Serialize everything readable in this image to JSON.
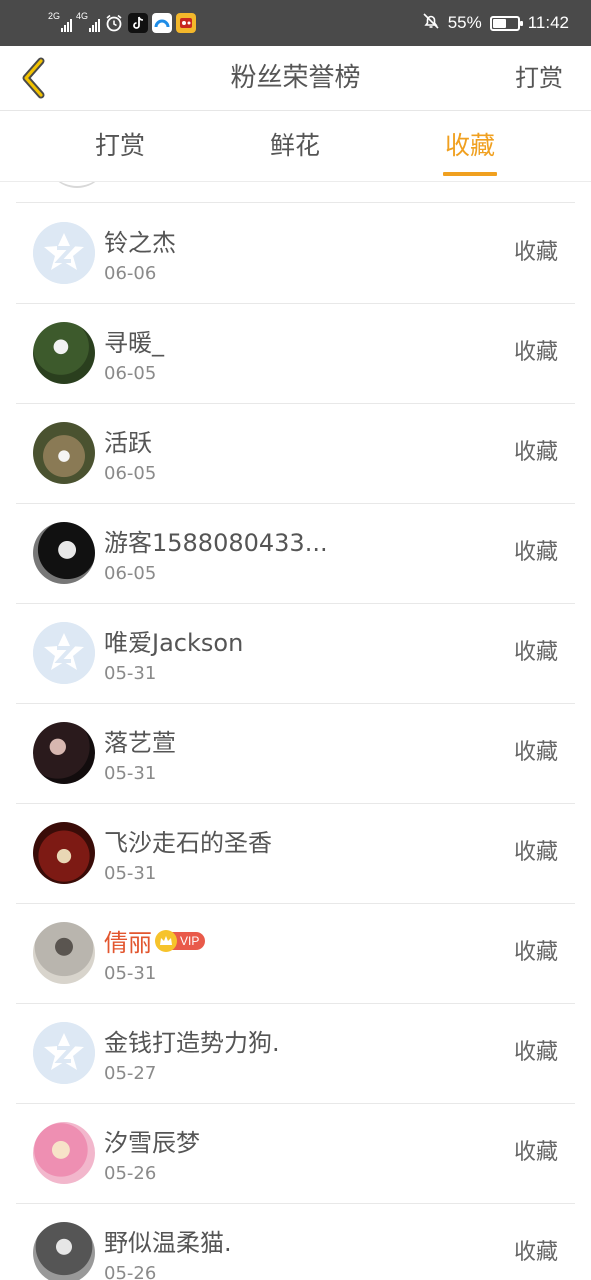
{
  "statusbar": {
    "sim1": "2G",
    "sim2": "4G",
    "app_icons": [
      "alarm-icon",
      "tiktok-icon",
      "browser-icon",
      "game-icon"
    ],
    "battery": "55%",
    "battery_level": 0.55,
    "time": "11:42"
  },
  "header": {
    "title": "粉丝荣誉榜",
    "action": "打赏"
  },
  "tabs": [
    {
      "label": "打赏"
    },
    {
      "label": "鲜花"
    },
    {
      "label": "收藏",
      "active": true
    }
  ],
  "list": {
    "items": [
      {
        "name": "铃之杰",
        "date": "06-06",
        "action": "收藏",
        "avatar": "default"
      },
      {
        "name": "寻暖_",
        "date": "06-05",
        "action": "收藏",
        "avatar": "photo-green"
      },
      {
        "name": "活跃",
        "date": "06-05",
        "action": "收藏",
        "avatar": "photo-forest"
      },
      {
        "name": "游客1588080433...",
        "date": "06-05",
        "action": "收藏",
        "avatar": "photo-mask"
      },
      {
        "name": "唯爱Jackson",
        "date": "05-31",
        "action": "收藏",
        "avatar": "default"
      },
      {
        "name": "落艺萱",
        "date": "05-31",
        "action": "收藏",
        "avatar": "photo-dark"
      },
      {
        "name": "飞沙走石的圣香",
        "date": "05-31",
        "action": "收藏",
        "avatar": "photo-red"
      },
      {
        "name": "倩丽",
        "date": "05-31",
        "action": "收藏",
        "avatar": "photo-grey",
        "vip": "VIP"
      },
      {
        "name": "金钱打造势力狗.",
        "date": "05-27",
        "action": "收藏",
        "avatar": "default"
      },
      {
        "name": "汐雪辰梦",
        "date": "05-26",
        "action": "收藏",
        "avatar": "photo-pink"
      },
      {
        "name": "野似温柔猫.",
        "date": "05-26",
        "action": "收藏",
        "avatar": "photo-bw"
      }
    ]
  },
  "colors": {
    "accent": "#f0a020",
    "vip_name": "#e2562f",
    "statusbar": "#4a4a4a"
  }
}
